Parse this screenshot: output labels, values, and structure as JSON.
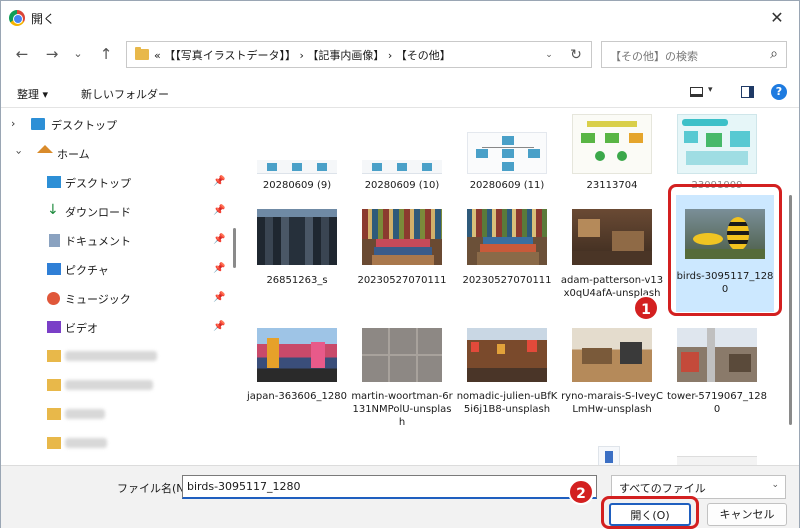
{
  "window": {
    "title": "開く"
  },
  "nav": {
    "back": "←",
    "forward": "→",
    "recent": "⌄",
    "up": "↑",
    "refresh": "↻"
  },
  "address": {
    "path": "« 【【写真イラストデータ】】 › 【記事内画像】 › 【その他】",
    "dropdown": "⌄"
  },
  "search": {
    "placeholder": "【その他】の検索",
    "icon": "⌕"
  },
  "toolbar": {
    "organize": "整理 ▾",
    "new_folder": "新しいフォルダー",
    "help": "?"
  },
  "sidebar": {
    "desktop_top": "デスクトップ",
    "home": "ホーム",
    "items": [
      {
        "label": "デスクトップ"
      },
      {
        "label": "ダウンロード"
      },
      {
        "label": "ドキュメント"
      },
      {
        "label": "ピクチャ"
      },
      {
        "label": "ミュージック"
      },
      {
        "label": "ビデオ"
      }
    ],
    "pin": "📌"
  },
  "files": {
    "row0": [
      "20280609 (9)",
      "20280609 (10)",
      "20280609 (11)",
      "23113704",
      "23091009"
    ],
    "row1": [
      "26851263_s",
      "20230527070111",
      "20230527070111",
      "adam-patterson-v13x0qU4afA-unsplash",
      "birds-3095117_1280"
    ],
    "row2": [
      "japan-363606_1280",
      "martin-woortman-6r131NMPolU-unsplash",
      "nomadic-julien-uBfK5i6j1B8-unsplash",
      "ryno-marais-S-IveyCLmHw-unsplash",
      "tower-5719067_1280"
    ]
  },
  "annotations": {
    "step1": "1",
    "step2": "2"
  },
  "footer": {
    "filename_label": "ファイル名(N):",
    "filename_value": "birds-3095117_1280",
    "filetype": "すべてのファイル",
    "open_button": "開く(O)",
    "cancel_button": "キャンセル"
  }
}
